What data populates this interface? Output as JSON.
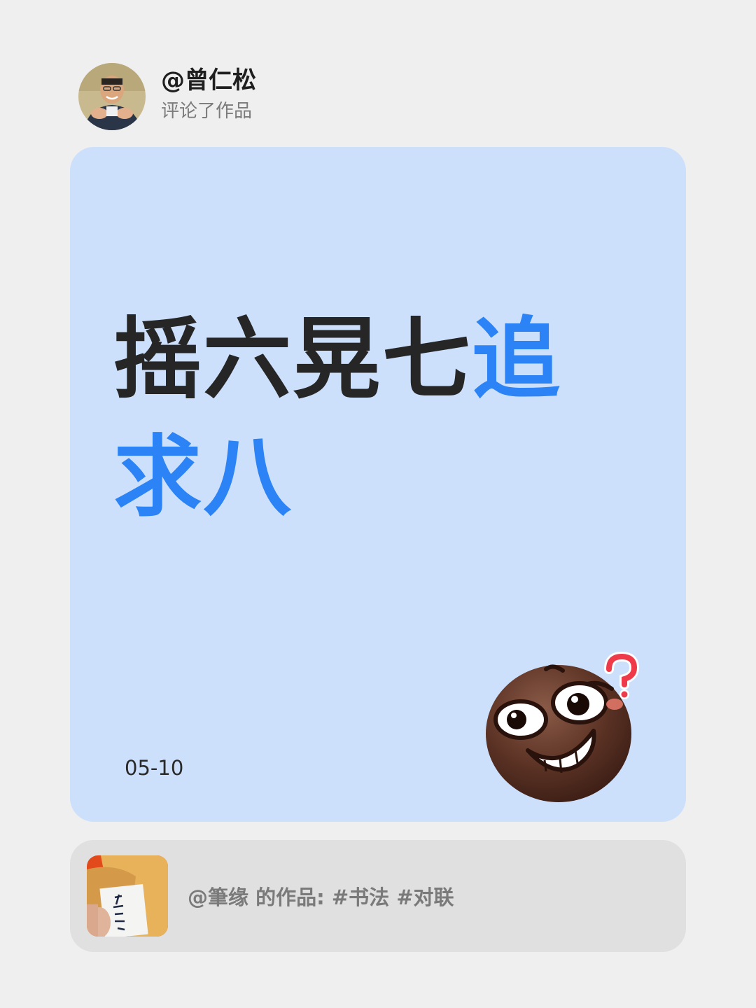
{
  "header": {
    "username": "@曾仁松",
    "action": "评论了作品",
    "avatar_icon": "user-avatar-photo"
  },
  "comment": {
    "text_dark": "摇六晃七",
    "text_highlight": "追求八",
    "highlight_color": "#2b83f6",
    "card_color": "#cde0fb"
  },
  "date": "05-10",
  "emoji_icon": "grinning-confused-face-icon",
  "source": {
    "author": "@筆缘",
    "middle": " 的作品: ",
    "tags": "#书法 #对联",
    "thumbnail_icon": "calligraphy-thumbnail"
  }
}
